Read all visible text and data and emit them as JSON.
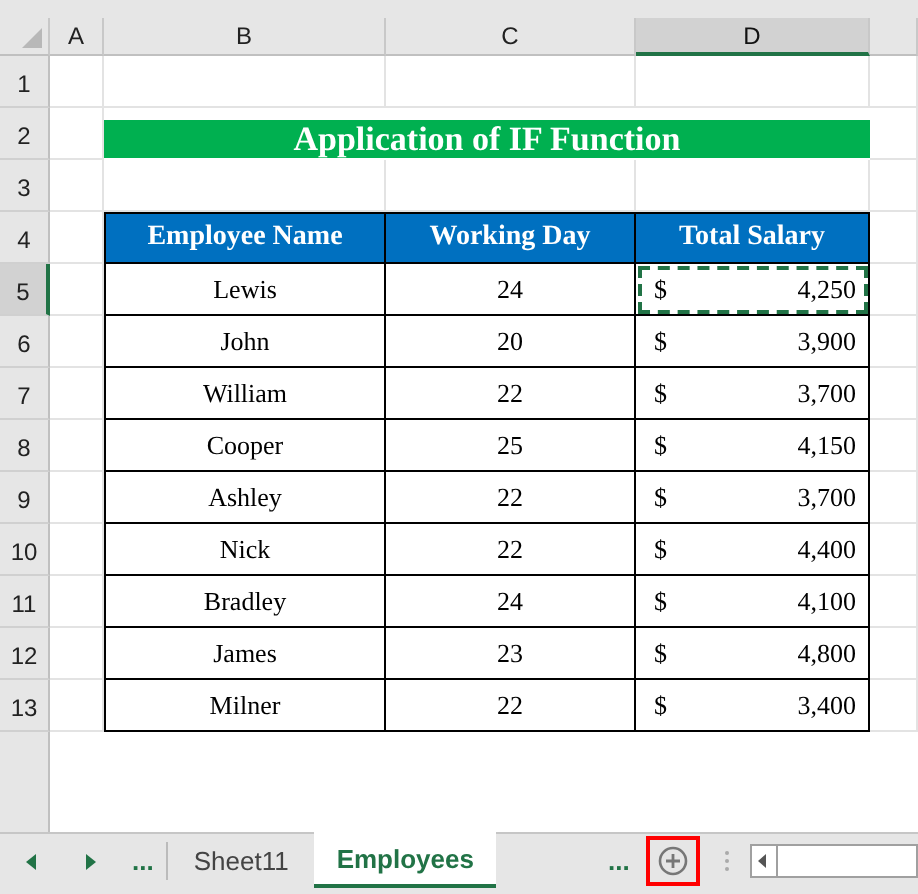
{
  "columns": [
    {
      "label": "A",
      "selected": false
    },
    {
      "label": "B",
      "selected": false
    },
    {
      "label": "C",
      "selected": false
    },
    {
      "label": "D",
      "selected": true
    }
  ],
  "rows": [
    {
      "label": "1",
      "selected": false
    },
    {
      "label": "2",
      "selected": false
    },
    {
      "label": "3",
      "selected": false
    },
    {
      "label": "4",
      "selected": false
    },
    {
      "label": "5",
      "selected": true
    },
    {
      "label": "6",
      "selected": false
    },
    {
      "label": "7",
      "selected": false
    },
    {
      "label": "8",
      "selected": false
    },
    {
      "label": "9",
      "selected": false
    },
    {
      "label": "10",
      "selected": false
    },
    {
      "label": "11",
      "selected": false
    },
    {
      "label": "12",
      "selected": false
    },
    {
      "label": "13",
      "selected": false
    }
  ],
  "title": "Application of IF Function",
  "table": {
    "columns": [
      "Employee Name",
      "Working Day",
      "Total Salary"
    ],
    "rows": [
      {
        "name": "Lewis",
        "working_day": "24",
        "currency": "$",
        "total_salary": "4,250",
        "selected": true
      },
      {
        "name": "John",
        "working_day": "20",
        "currency": "$",
        "total_salary": "3,900",
        "selected": false
      },
      {
        "name": "William",
        "working_day": "22",
        "currency": "$",
        "total_salary": "3,700",
        "selected": false
      },
      {
        "name": "Cooper",
        "working_day": "25",
        "currency": "$",
        "total_salary": "4,150",
        "selected": false
      },
      {
        "name": "Ashley",
        "working_day": "22",
        "currency": "$",
        "total_salary": "3,700",
        "selected": false
      },
      {
        "name": "Nick",
        "working_day": "22",
        "currency": "$",
        "total_salary": "4,400",
        "selected": false
      },
      {
        "name": "Bradley",
        "working_day": "24",
        "currency": "$",
        "total_salary": "4,100",
        "selected": false
      },
      {
        "name": "James",
        "working_day": "23",
        "currency": "$",
        "total_salary": "4,800",
        "selected": false
      },
      {
        "name": "Milner",
        "working_day": "22",
        "currency": "$",
        "total_salary": "3,400",
        "selected": false
      }
    ]
  },
  "sheet_bar": {
    "more_left": "...",
    "tabs": [
      {
        "label": "Sheet11",
        "selected": false
      },
      {
        "label": "Employees",
        "selected": true
      }
    ],
    "more_right": "...",
    "add_button_highlighted": true
  }
}
